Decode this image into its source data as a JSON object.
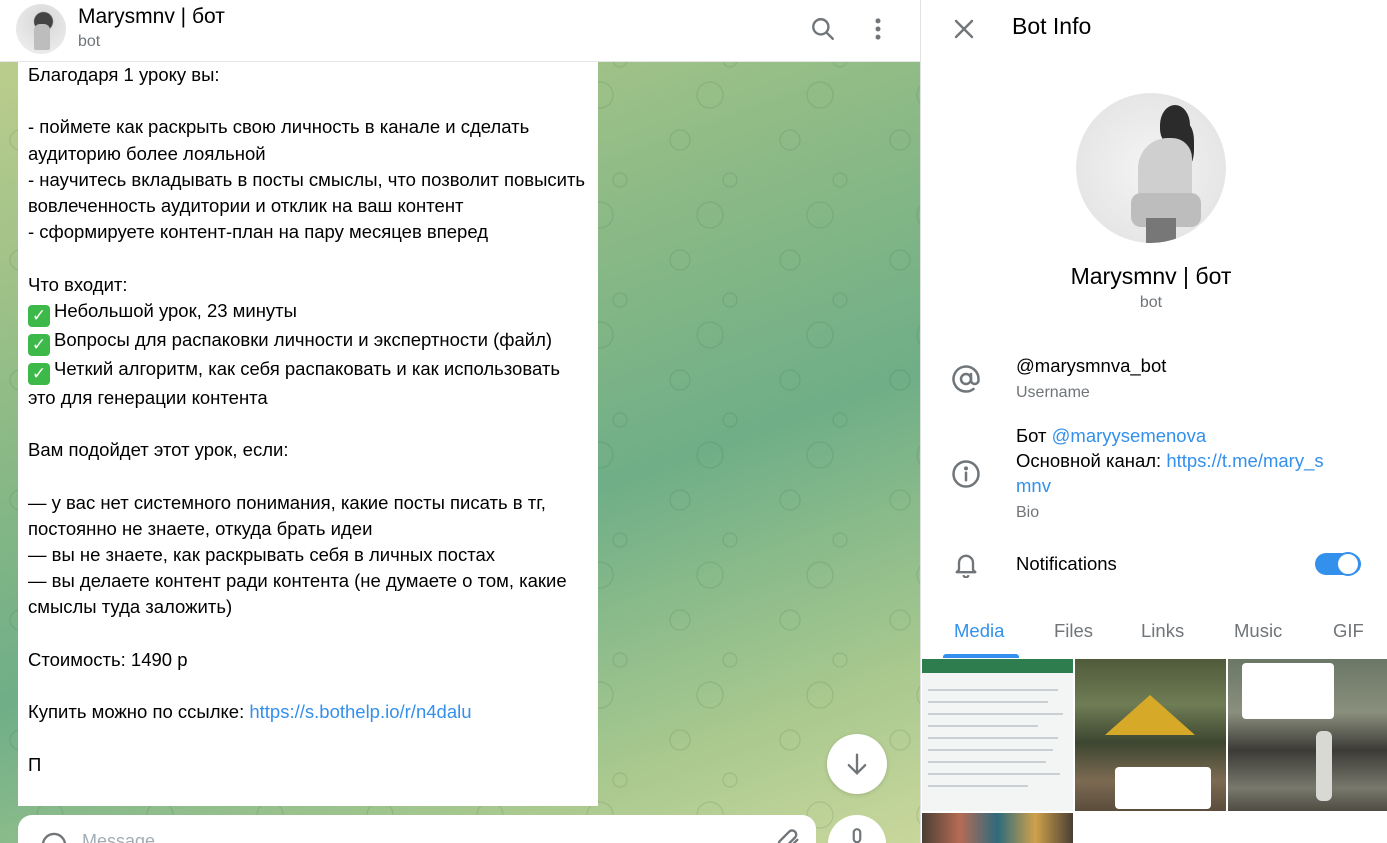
{
  "chat": {
    "title": "Marysmnv | бот",
    "subtitle": "bot",
    "icons": {
      "search": "search-icon",
      "more": "more-vertical-icon",
      "scroll": "arrow-down-icon",
      "emoji": "smile-icon",
      "attach": "paperclip-icon",
      "mic": "microphone-icon"
    },
    "message": {
      "line1": "Благодаря 1 уроку вы:",
      "bullets1": "- поймете как раскрыть свою личность в канале и сделать аудиторию более лояльной\n- научитесь вкладывать в посты смыслы, что позволит повысить вовлеченность аудитории и отклик на ваш контент\n- сформируете контент-план на пару месяцев вперед",
      "includes_heading": "Что входит:",
      "check1": "Небольшой урок, 23 минуты",
      "check2": "Вопросы для распаковки личности и экспертности (файл)",
      "check3": "Четкий алгоритм, как себя распаковать и как использовать это для генерации контента",
      "suits_heading": "Вам подойдет этот урок, если:",
      "bullets2": "— у вас нет системного понимания, какие посты писать в тг, постоянно не знаете, откуда брать идеи\n— вы не знаете, как раскрывать себя в личных постах\n— вы делаете контент ради контента (не думаете о том, какие смыслы туда заложить)",
      "price_label": "Стоимость:",
      "price_value": " 1490 р",
      "buy_label": "Купить можно по ссылке:",
      "buy_link": "https://s.bothelp.io/r/n4dalu",
      "tail": "П"
    },
    "composer_placeholder": "Message"
  },
  "info": {
    "header_title": "Bot Info",
    "name": "Marysmnv | бот",
    "subtitle": "bot",
    "username": "@marysmnva_bot",
    "username_caption": "Username",
    "bio_line1_prefix": "Бот ",
    "bio_line1_link": "@maryysemenova",
    "bio_line2_prefix": "Основной канал: ",
    "bio_line2_link_a": "https://t.me/mary_s",
    "bio_line2_link_b": "mnv",
    "bio_caption": "Bio",
    "notifications_label": "Notifications",
    "notifications_on": true,
    "tabs": [
      "Media",
      "Files",
      "Links",
      "Music",
      "GIF"
    ],
    "active_tab": "Media",
    "accent_color": "#3390ec"
  }
}
